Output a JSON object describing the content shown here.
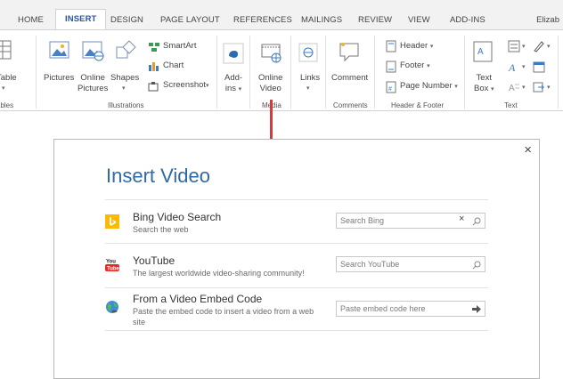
{
  "ribbon": {
    "tabs": [
      {
        "label": "HOME"
      },
      {
        "label": "INSERT"
      },
      {
        "label": "DESIGN"
      },
      {
        "label": "PAGE LAYOUT"
      },
      {
        "label": "REFERENCES"
      },
      {
        "label": "MAILINGS"
      },
      {
        "label": "REVIEW"
      },
      {
        "label": "VIEW"
      },
      {
        "label": "ADD-INS"
      }
    ],
    "user": "Elizab",
    "tables": {
      "label": "Table",
      "group": "Tables"
    },
    "illustrations": {
      "pictures": "Pictures",
      "online_pictures_1": "Online",
      "online_pictures_2": "Pictures",
      "shapes": "Shapes",
      "smartart": "SmartArt",
      "chart": "Chart",
      "screenshot": "Screenshot",
      "group": "Illustrations"
    },
    "addins": {
      "label_1": "Add-",
      "label_2": "ins"
    },
    "media": {
      "online_video_1": "Online",
      "online_video_2": "Video",
      "group": "Media"
    },
    "links": {
      "label": "Links"
    },
    "comments": {
      "label": "Comment",
      "group": "Comments"
    },
    "header_footer": {
      "header": "Header",
      "footer": "Footer",
      "page_number": "Page Number",
      "group": "Header & Footer"
    },
    "text": {
      "text_box_1": "Text",
      "text_box_2": "Box",
      "group": "Text"
    }
  },
  "dialog": {
    "title": "Insert Video",
    "close": "×",
    "rows": [
      {
        "icon": "bing-icon",
        "title": "Bing Video Search",
        "description": "Search the web",
        "placeholder": "Search Bing"
      },
      {
        "icon": "youtube-icon",
        "title": "YouTube",
        "description": "The largest worldwide video-sharing community!",
        "placeholder": "Search YouTube"
      },
      {
        "icon": "globe-icon",
        "title": "From a Video Embed Code",
        "description_1": "Paste the embed code to insert a video from a web",
        "description_2": "site",
        "placeholder": "Paste embed code here"
      }
    ]
  },
  "colors": {
    "accent": "#2b579a",
    "title_blue": "#2e6aa6",
    "callout_red": "#d63b3b",
    "bing_orange": "#ffb900",
    "youtube_red": "#e52d27"
  }
}
